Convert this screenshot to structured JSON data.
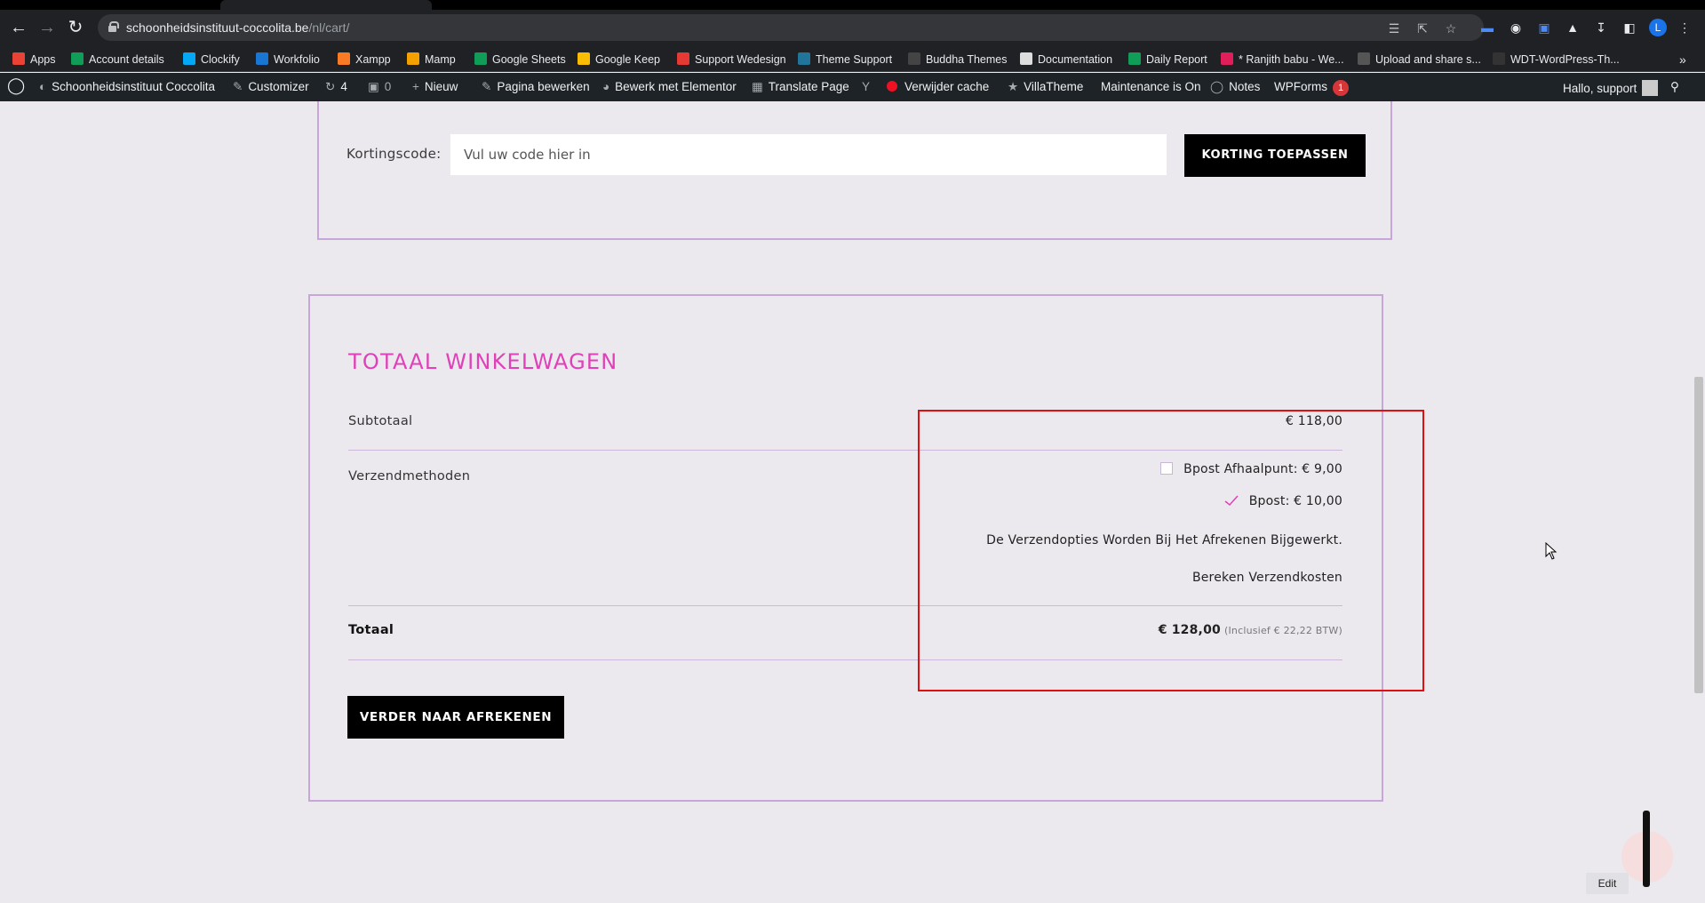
{
  "browser": {
    "url_host": "schoonheidsinstituut-coccolita.be",
    "url_path": "/nl/cart/",
    "profile_initial": "L",
    "bookmarks": [
      {
        "label": "Apps",
        "color": "#ea4335"
      },
      {
        "label": "Account details",
        "color": "#0f9d58"
      },
      {
        "label": "Clockify",
        "color": "#03a9f4"
      },
      {
        "label": "Workfolio",
        "color": "#1976d2"
      },
      {
        "label": "Xampp",
        "color": "#fb7a24"
      },
      {
        "label": "Mamp",
        "color": "#f4a100"
      },
      {
        "label": "Google Sheets",
        "color": "#0f9d58"
      },
      {
        "label": "Google Keep",
        "color": "#fbbc04"
      },
      {
        "label": "Support Wedesign",
        "color": "#e53935"
      },
      {
        "label": "Theme Support",
        "color": "#21759b"
      },
      {
        "label": "Buddha Themes",
        "color": "#444444"
      },
      {
        "label": "Documentation",
        "color": "#dddddd"
      },
      {
        "label": "Daily Report",
        "color": "#0f9d58"
      },
      {
        "label": "* Ranjith babu - We...",
        "color": "#e01e5a"
      },
      {
        "label": "Upload and share s...",
        "color": "#555555"
      },
      {
        "label": "WDT-WordPress-Th...",
        "color": "#333333"
      }
    ]
  },
  "adminbar": {
    "site_name": "Schoonheidsinstituut Coccolita",
    "customizer": "Customizer",
    "updates_count": "4",
    "comments_count": "0",
    "new": "Nieuw",
    "edit_page": "Pagina bewerken",
    "elementor": "Bewerk met Elementor",
    "translate": "Translate Page",
    "clear_cache": "Verwijder cache",
    "villatheme": "VillaTheme",
    "maintenance": "Maintenance is On",
    "notes": "Notes",
    "wpforms": "WPForms",
    "wpforms_badge": "1",
    "greeting": "Hallo, support"
  },
  "coupon": {
    "label": "Kortingscode:",
    "placeholder": "Vul uw code hier in",
    "button": "KORTING TOEPASSEN"
  },
  "totals": {
    "title": "TOTAAL WINKELWAGEN",
    "subtotal_label": "Subtotaal",
    "subtotal_value": "€ 118,00",
    "shipping_label": "Verzendmethoden",
    "shipping_options": [
      {
        "label": "Bpost Afhaalpunt: € 9,00",
        "selected": false
      },
      {
        "label": "Bpost: € 10,00",
        "selected": true
      }
    ],
    "shipping_note": "De Verzendopties Worden Bij Het Afrekenen Bijgewerkt.",
    "calc_shipping": "Bereken Verzendkosten",
    "total_label": "Totaal",
    "total_value": "€ 128,00",
    "total_tax": "(Inclusief € 22,22 BTW)",
    "checkout_button": "VERDER NAAR AFREKENEN"
  },
  "widgets": {
    "edit": "Edit"
  },
  "colors": {
    "accent_pink": "#e040b8",
    "box_border": "#c7a6d9",
    "highlight_red": "#e01010"
  }
}
